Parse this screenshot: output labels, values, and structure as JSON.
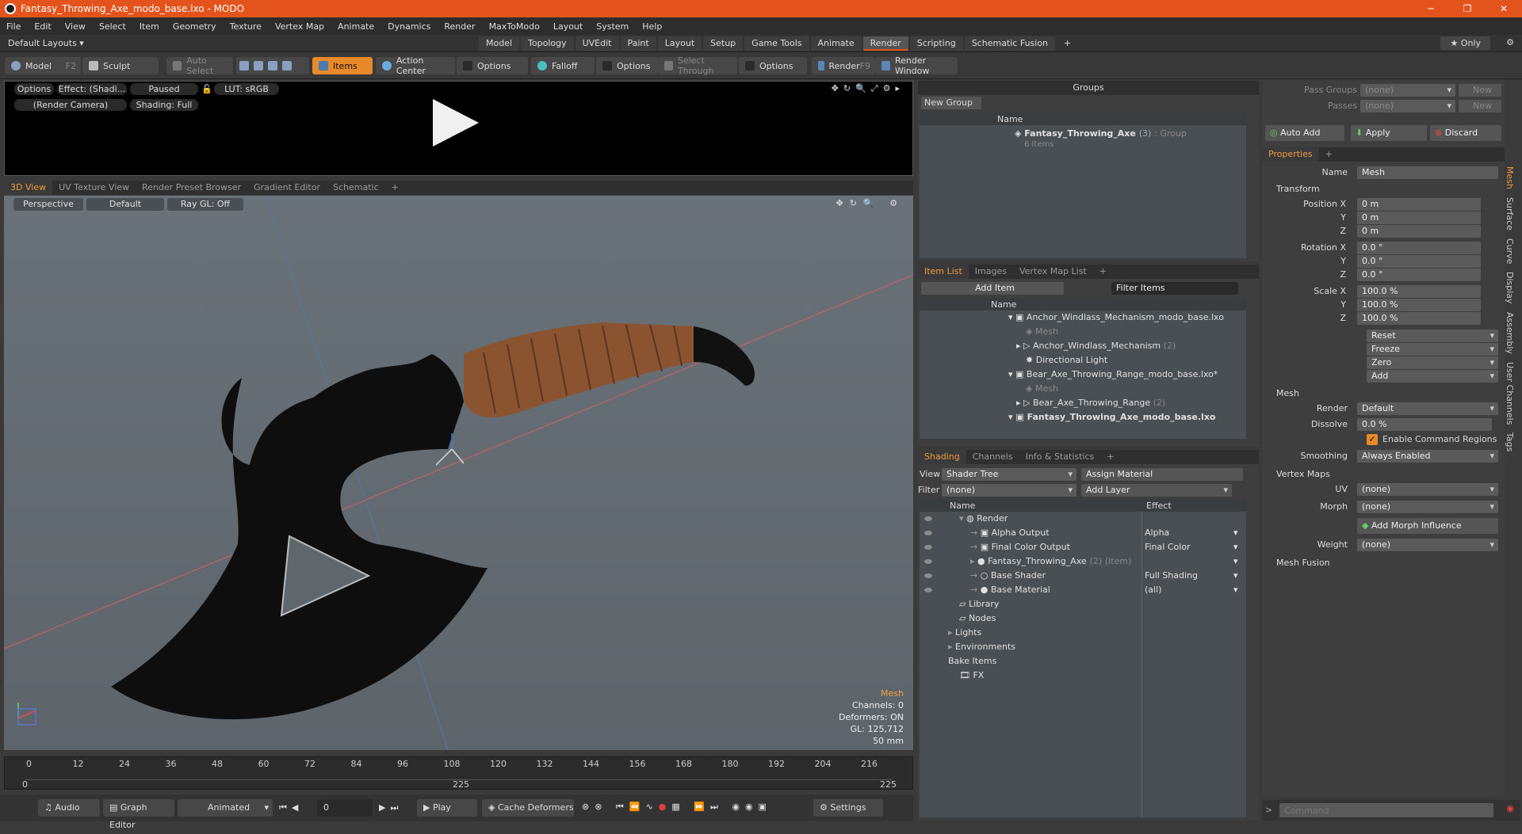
{
  "window": {
    "title": "Fantasy_Throwing_Axe_modo_base.lxo - MODO",
    "controls": [
      "─",
      "❐",
      "✕"
    ]
  },
  "menu": [
    "File",
    "Edit",
    "View",
    "Select",
    "Item",
    "Geometry",
    "Texture",
    "Vertex Map",
    "Animate",
    "Dynamics",
    "Render",
    "MaxToModo",
    "Layout",
    "System",
    "Help"
  ],
  "layout_bar": {
    "layouts_label": "Default Layouts ▾",
    "tabs": [
      "Model",
      "Topology",
      "UVEdit",
      "Paint",
      "Layout",
      "Setup",
      "Game Tools",
      "Animate",
      "Render",
      "Scripting",
      "Schematic Fusion"
    ],
    "active_tab": "Render",
    "add": "+",
    "only": "★ Only"
  },
  "toolbar": {
    "model": "Model",
    "model_key": "F2",
    "sculpt": "Sculpt",
    "auto_select": "Auto Select",
    "items": "Items",
    "action_center": "Action Center",
    "options1": "Options",
    "falloff": "Falloff",
    "options2": "Options",
    "select_through": "Select Through",
    "options3": "Options",
    "render": "Render",
    "render_key": "F9",
    "render_window": "Render Window"
  },
  "preview": {
    "options": "Options",
    "effect": "Effect: (Shadi...",
    "paused": "Paused",
    "lut": "LUT: sRGB",
    "camera": "(Render Camera)",
    "shading": "Shading: Full"
  },
  "viewport_tabs": [
    "3D View",
    "UV Texture View",
    "Render Preset Browser",
    "Gradient Editor",
    "Schematic",
    "+"
  ],
  "viewport": {
    "perspective": "Perspective",
    "default": "Default",
    "raygl": "Ray GL: Off",
    "info_title": "Mesh",
    "channels": "Channels: 0",
    "deformers": "Deformers: ON",
    "gl": "GL: 125,712",
    "mm": "50 mm"
  },
  "timeline": {
    "ticks": [
      "0",
      "12",
      "24",
      "36",
      "48",
      "60",
      "72",
      "84",
      "96",
      "108",
      "120",
      "132",
      "144",
      "156",
      "168",
      "180",
      "192",
      "204",
      "216"
    ],
    "start": "0",
    "mid": "225",
    "end": "225"
  },
  "bottombar": {
    "audio": "Audio",
    "graph_editor": "Graph Editor",
    "animated": "Animated",
    "frame": "0",
    "play": "Play",
    "cache_deformers": "Cache Deformers",
    "settings": "Settings"
  },
  "groups": {
    "title": "Groups",
    "new_group": "New Group",
    "col_name": "Name",
    "group_name": "Fantasy_Throwing_Axe",
    "group_count": "(3)",
    "group_type": ": Group",
    "group_items": "6 Items"
  },
  "item_list": {
    "tabs": [
      "Item List",
      "Images",
      "Vertex Map List",
      "+"
    ],
    "add_item": "Add Item",
    "filter": "Filter Items",
    "col_name": "Name",
    "rows": [
      {
        "text": "Anchor_Windlass_Mechanism_modo_base.lxo",
        "style": ""
      },
      {
        "text": "Mesh",
        "style": "dim"
      },
      {
        "text": "Anchor_Windlass_Mechanism",
        "extra": "(2)",
        "style": ""
      },
      {
        "text": "Directional Light",
        "style": ""
      },
      {
        "text": "Bear_Axe_Throwing_Range_modo_base.lxo*",
        "style": ""
      },
      {
        "text": "Mesh",
        "style": "dim"
      },
      {
        "text": "Bear_Axe_Throwing_Range",
        "extra": "(2)",
        "style": ""
      },
      {
        "text": "Fantasy_Throwing_Axe_modo_base.lxo",
        "style": "bold"
      }
    ]
  },
  "shading": {
    "tabs": [
      "Shading",
      "Channels",
      "Info & Statistics",
      "+"
    ],
    "view_label": "View",
    "view_value": "Shader Tree",
    "assign": "Assign Material",
    "filter_label": "Filter",
    "filter_value": "(none)",
    "add_layer": "Add Layer",
    "col_name": "Name",
    "col_effect": "Effect",
    "rows": [
      {
        "name": "Render",
        "effect": ""
      },
      {
        "name": "Alpha Output",
        "effect": "Alpha"
      },
      {
        "name": "Final Color Output",
        "effect": "Final Color"
      },
      {
        "name": "Fantasy_Throwing_Axe",
        "extra": "(2) (Item)",
        "effect": ""
      },
      {
        "name": "Base Shader",
        "effect": "Full Shading"
      },
      {
        "name": "Base Material",
        "effect": "(all)"
      },
      {
        "name": "Library",
        "effect": ""
      },
      {
        "name": "Nodes",
        "effect": ""
      },
      {
        "name": "Lights",
        "effect": ""
      },
      {
        "name": "Environments",
        "effect": ""
      },
      {
        "name": "Bake Items",
        "effect": ""
      },
      {
        "name": "FX",
        "effect": ""
      }
    ]
  },
  "properties": {
    "pass_groups_label": "Pass Groups",
    "pass_groups_value": "(none)",
    "passes_label": "Passes",
    "passes_value": "(none)",
    "new1": "New",
    "new2": "New",
    "auto_add": "Auto Add",
    "apply": "Apply",
    "discard": "Discard",
    "tab": "Properties",
    "name_label": "Name",
    "name_value": "Mesh",
    "transform": "Transform",
    "position_x_label": "Position X",
    "position_x": "0 m",
    "position_y": "0 m",
    "position_z": "0 m",
    "rotation_x_label": "Rotation X",
    "rotation_x": "0.0 °",
    "rotation_y": "0.0 °",
    "rotation_z": "0.0 °",
    "scale_x_label": "Scale X",
    "scale_x": "100.0 %",
    "scale_y": "100.0 %",
    "scale_z": "100.0 %",
    "y_label": "Y",
    "z_label": "Z",
    "reset": "Reset",
    "freeze": "Freeze",
    "zero": "Zero",
    "add": "Add",
    "mesh_section": "Mesh",
    "render_label": "Render",
    "render_value": "Default",
    "dissolve_label": "Dissolve",
    "dissolve_value": "0.0 %",
    "enable_cmd": "Enable Command Regions",
    "smoothing_label": "Smoothing",
    "smoothing_value": "Always Enabled",
    "vertex_maps": "Vertex Maps",
    "uv_label": "UV",
    "uv_value": "(none)",
    "morph_label": "Morph",
    "morph_value": "(none)",
    "add_morph": "Add Morph Influence",
    "weight_label": "Weight",
    "weight_value": "(none)",
    "mesh_fusion": "Mesh Fusion",
    "side_tabs": [
      "Mesh",
      "Surface",
      "Curve",
      "Display",
      "Assembly",
      "User Channels",
      "Tags"
    ],
    "command_placeholder": "Command"
  }
}
